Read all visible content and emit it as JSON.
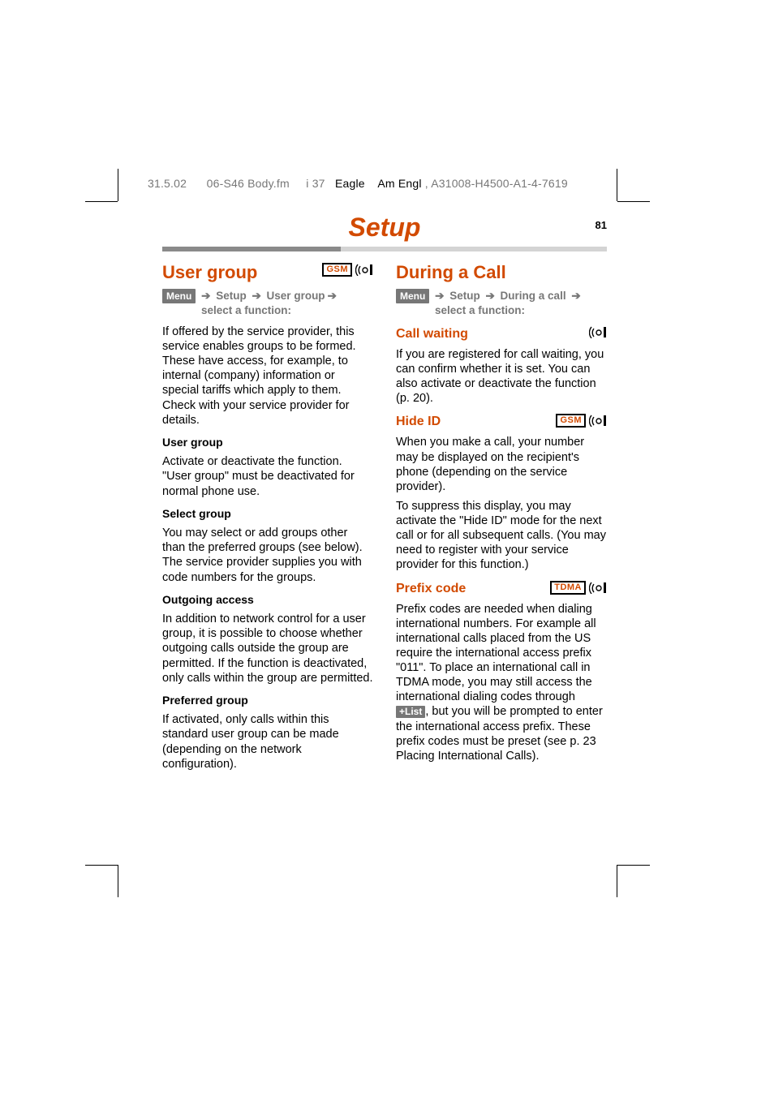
{
  "header": {
    "date": "31.5.02",
    "file": "06-S46 Body.fm",
    "sheet": "i 37",
    "project": "Eagle",
    "lang": "Am Engl",
    "doc_id": ", A31008-H4500-A1-4-7619"
  },
  "page": {
    "title": "Setup",
    "number": "81"
  },
  "left": {
    "heading": "User group",
    "badge": "GSM",
    "nav": {
      "menu": "Menu",
      "arrow": "➔",
      "step1": "Setup",
      "step2": "User group",
      "tail": "select a function:"
    },
    "intro": "If offered by the service provider, this service enables groups to be formed. These have access, for example, to internal (company) information or special tariffs which apply to them. Check with your service provider for details.",
    "s1_title": "User group",
    "s1_body": "Activate or deactivate the function. \"User group\" must be deactivated for normal phone use.",
    "s2_title": "Select group",
    "s2_body": "You may select or add groups other than the preferred groups (see below). The service provider supplies you with code numbers for the groups.",
    "s3_title": "Outgoing access",
    "s3_body": "In addition to network control for a user group, it is possible to choose whether outgoing calls outside the group are permitted. If the function is deactivated, only calls within the group are permitted.",
    "s4_title": "Preferred group",
    "s4_body": "If activated, only calls within this standard user group can be made (depending on the network configuration)."
  },
  "right": {
    "heading": "During a Call",
    "nav": {
      "menu": "Menu",
      "arrow": "➔",
      "step1": "Setup",
      "step2": "During a call",
      "tail": "select a function:"
    },
    "cw_title": "Call waiting",
    "cw_body": "If you are registered for call waiting, you can confirm whether it is set. You can also activate or deactivate the function (p. 20).",
    "hide_title": "Hide ID",
    "hide_badge": "GSM",
    "hide_p1": "When you make a call, your number may be displayed on the recipient's phone (depending on the service provider).",
    "hide_p2": "To suppress this display, you may activate the \"Hide ID\" mode for the next call or for all subsequent calls. (You may need to register with your service provider for this function.)",
    "prefix_title": "Prefix code",
    "prefix_badge": "TDMA",
    "prefix_p1a": "Prefix codes are needed when dialing international numbers.  For example all international calls placed from the US require the international access prefix \"011\".  To place an international call in TDMA mode, you may still access the international dialing codes through ",
    "prefix_list": "+List",
    "prefix_p1b": ", but you will be prompted to enter the international access prefix.  These prefix codes must be preset (see p. 23 Placing International Calls)."
  }
}
